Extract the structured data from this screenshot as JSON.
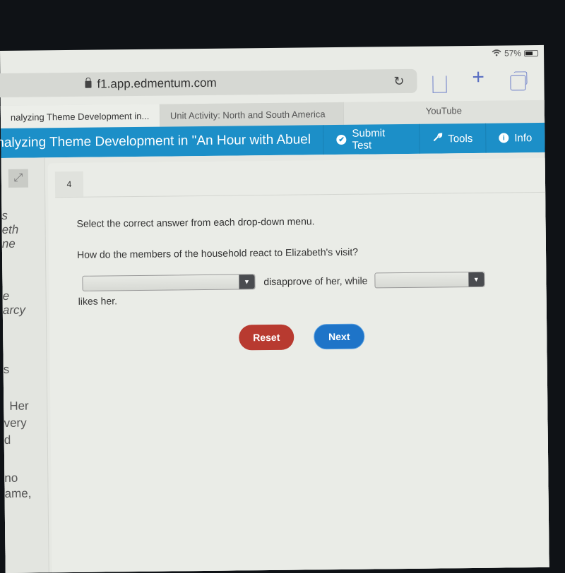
{
  "status_bar": {
    "wifi_icon": "wifi-icon",
    "battery_percent": "57%",
    "battery_level": 0.57
  },
  "browser": {
    "url": "f1.app.edmentum.com",
    "reload_icon": "↻",
    "plus_icon": "+",
    "tabs": [
      {
        "label": "nalyzing Theme Development in...",
        "active": true
      },
      {
        "label": "Unit Activity: North and South America",
        "active": false
      },
      {
        "label": "YouTube",
        "active": false
      }
    ]
  },
  "appbar": {
    "title": "nalyzing Theme Development in \"An Hour with Abuel",
    "submit_label": "Submit Test",
    "tools_label": "Tools",
    "info_label": "Info",
    "check_glyph": "✔",
    "wrench_glyph": "🔧",
    "info_glyph": "i",
    "color": "#1c8fc8"
  },
  "left_pane": {
    "expand_glyph": "⤢",
    "passage_fragments": [
      {
        "text": "s",
        "italic": true
      },
      {
        "text": "eth",
        "italic": true
      },
      {
        "text": "ne",
        "italic": true
      },
      {
        "text": "e",
        "italic": true
      },
      {
        "text": "arcy",
        "italic": true
      },
      {
        "text": "s",
        "italic": false
      },
      {
        "text": "Her",
        "italic": false
      },
      {
        "text": "very",
        "italic": false
      },
      {
        "text": "d",
        "italic": false
      },
      {
        "text": "no",
        "italic": false
      },
      {
        "text": "ame,",
        "italic": false
      }
    ]
  },
  "question": {
    "number": "4",
    "instruction": "Select the correct answer from each drop-down menu.",
    "prompt": "How do the members of the household react to Elizabeth's visit?",
    "dropdown1_value": "",
    "middle_text": "disapprove of her, while",
    "dropdown2_value": "",
    "end_text": "likes her.",
    "arrow_glyph": "▼"
  },
  "buttons": {
    "reset_label": "Reset",
    "next_label": "Next",
    "reset_color": "#b83a30",
    "next_color": "#1e74c8"
  }
}
